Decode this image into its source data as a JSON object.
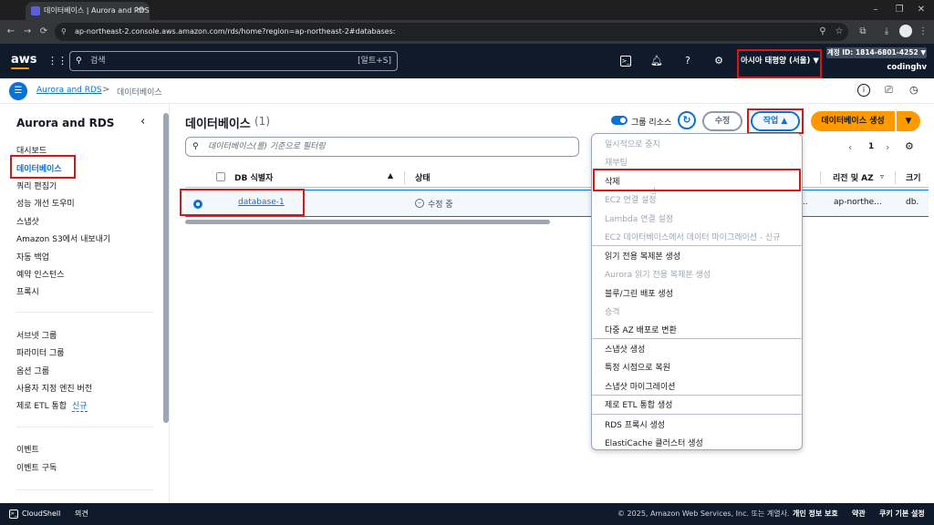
{
  "browser": {
    "tab_title": "데이터베이스 | Aurora and RDS",
    "url": "ap-northeast-2.console.aws.amazon.com/rds/home?region=ap-northeast-2#databases:"
  },
  "topnav": {
    "logo": "aws",
    "search_placeholder": "검색",
    "search_shortcut": "[알트+S]",
    "region": "아시아 태평양 (서울) ▼",
    "account": "계정 ID: 1814-6801-4252 ▼",
    "username": "codinghv"
  },
  "breadcrumb": {
    "root": "Aurora and RDS",
    "separator": ">",
    "current": "데이터베이스"
  },
  "sidebar": {
    "title": "Aurora and RDS",
    "group1": [
      {
        "label": "대시보드"
      },
      {
        "label": "데이터베이스"
      },
      {
        "label": "쿼리 편집기"
      },
      {
        "label": "성능 개선 도우미"
      },
      {
        "label": "스냅샷"
      },
      {
        "label": "Amazon S3에서 내보내기"
      },
      {
        "label": "자동 백업"
      },
      {
        "label": "예약 인스턴스"
      },
      {
        "label": "프록시"
      }
    ],
    "group2": [
      {
        "label": "서브넷 그룹"
      },
      {
        "label": "파라미터 그룹"
      },
      {
        "label": "옵션 그룹"
      },
      {
        "label": "사용자 지정 엔진 버전"
      },
      {
        "label": "제로 ETL 통합"
      }
    ],
    "new_badge": "신규",
    "group3": [
      {
        "label": "이벤트"
      },
      {
        "label": "이벤트 구독"
      }
    ]
  },
  "main": {
    "heading": "데이터베이스",
    "count": "(1)",
    "group_resources_label": "그룹 리소스",
    "modify_button": "수정",
    "actions_button": "작업 ▲",
    "create_button": "데이터베이스 생성",
    "filter_placeholder": "데이터베이스(를) 기준으로 필터링",
    "pagination_page": "1",
    "columns": [
      "DB 식별자",
      "상태",
      "리전 및 AZ",
      "크기"
    ],
    "row": {
      "identifier": "database-1",
      "status": "수정 중",
      "region_az": "ap-northe...",
      "size": "db.",
      "truncated": "..."
    }
  },
  "dropdown": {
    "items": [
      {
        "label": "일시적으로 중지",
        "enabled": false
      },
      {
        "label": "재부팅",
        "enabled": false
      },
      {
        "label": "삭제",
        "enabled": true
      },
      {
        "label": "EC2 연결 설정",
        "enabled": false
      },
      {
        "label": "Lambda 연결 설정",
        "enabled": false
      },
      {
        "label": "EC2 데이터베이스에서 데이터 마이그레이션 - 신규",
        "enabled": false
      },
      {
        "label": "읽기 전용 복제본 생성",
        "enabled": true
      },
      {
        "label": "Aurora 읽기 전용 복제본 생성",
        "enabled": false
      },
      {
        "label": "블루/그린 배포 생성",
        "enabled": true
      },
      {
        "label": "승격",
        "enabled": false
      },
      {
        "label": "다중 AZ 배포로 변환",
        "enabled": true
      },
      {
        "label": "스냅샷 생성",
        "enabled": true
      },
      {
        "label": "특정 시점으로 복원",
        "enabled": true
      },
      {
        "label": "스냅샷 마이그레이션",
        "enabled": true
      },
      {
        "label": "제로 ETL 통합 생성",
        "enabled": true
      },
      {
        "label": "RDS 프록시 생성",
        "enabled": true
      },
      {
        "label": "ElastiCache 클러스터 생성",
        "enabled": true
      }
    ]
  },
  "footer": {
    "cloudshell": "CloudShell",
    "feedback": "의견",
    "copyright": "© 2025, Amazon Web Services, Inc. 또는 계열사.",
    "privacy": "개인 정보 보호",
    "terms": "약관",
    "cookies": "쿠키 기본 설정"
  },
  "colors": {
    "aws_nav": "#0f1b2a",
    "link_blue": "#0972d3",
    "primary_orange": "#ff9900",
    "highlight_red": "#d91515"
  }
}
